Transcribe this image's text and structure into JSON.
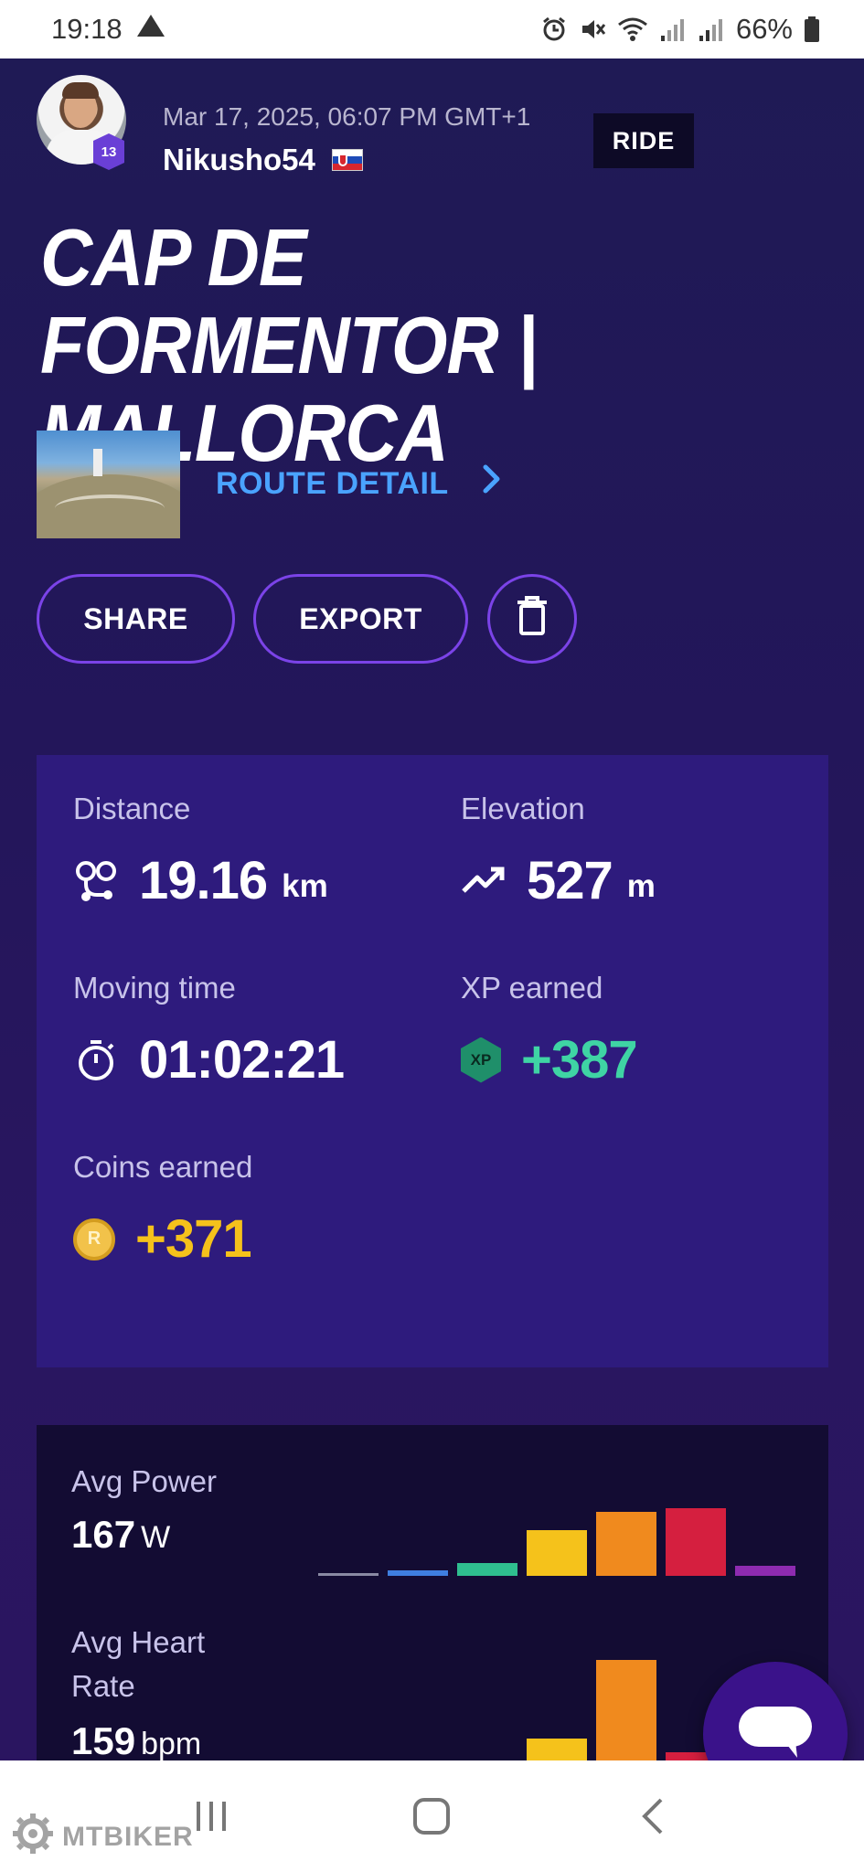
{
  "status_bar": {
    "time": "19:18",
    "battery": "66%"
  },
  "header": {
    "level": "13",
    "date": "Mar 17, 2025, 06:07 PM GMT+1",
    "username": "Nikusho54",
    "activity_type": "RIDE"
  },
  "title": "CAP DE FORMENTOR | MALLORCA",
  "route": {
    "label": "ROUTE DETAIL",
    "chevron": "›"
  },
  "actions": {
    "share": "SHARE",
    "export": "EXPORT"
  },
  "stats": {
    "distance": {
      "label": "Distance",
      "value": "19.16",
      "unit": "km"
    },
    "elevation": {
      "label": "Elevation",
      "value": "527",
      "unit": "m"
    },
    "moving_time": {
      "label": "Moving time",
      "value": "01:02:21"
    },
    "xp": {
      "label": "XP earned",
      "value": "+387",
      "icon_text": "XP"
    },
    "coins": {
      "label": "Coins earned",
      "value": "+371",
      "icon_text": "R"
    }
  },
  "metrics": {
    "power": {
      "label": "Avg Power",
      "value": "167",
      "unit": "W",
      "zone_levels": [
        0.02,
        0.05,
        0.12,
        0.42,
        0.58,
        0.62,
        0.09
      ]
    },
    "heart_rate": {
      "label_line1": "Avg Heart",
      "label_line2": "Rate",
      "value": "159",
      "unit": "bpm",
      "zone_levels": [
        0.02,
        0.0,
        0.05,
        0.28,
        1.0,
        0.16,
        0.0
      ]
    },
    "zone_colors": [
      "#8a8aa3",
      "#3f7fe0",
      "#2fbf8f",
      "#f5c21b",
      "#f08a1e",
      "#d51f3f",
      "#8e2bb0"
    ]
  },
  "watermark": "MTBIKER"
}
